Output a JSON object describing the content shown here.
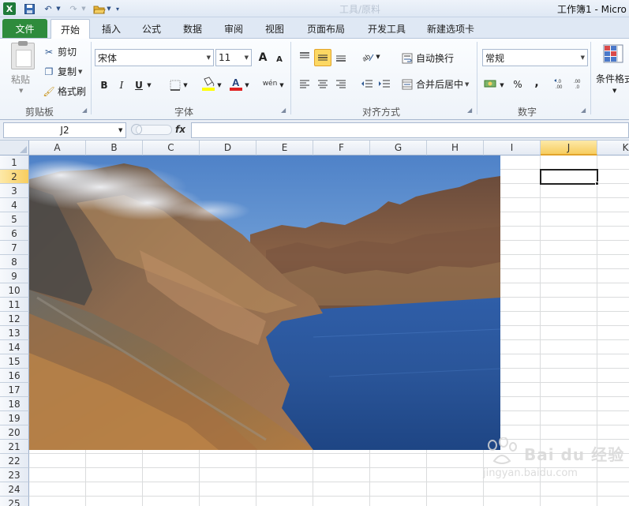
{
  "window": {
    "title": "工作簿1 - Micro",
    "faded_title": "工具/原料"
  },
  "quick_access": {
    "app_icon": "X",
    "save_icon": "save-icon",
    "undo_icon": "undo-icon",
    "redo_icon": "redo-icon",
    "open_icon": "open-folder-icon"
  },
  "tabs": {
    "file": "文件",
    "home": "开始",
    "insert": "插入",
    "formulas": "公式",
    "data": "数据",
    "review": "审阅",
    "view": "视图",
    "page_layout": "页面布局",
    "developer": "开发工具",
    "new_tab": "新建选项卡"
  },
  "clipboard": {
    "paste": "粘贴",
    "cut": "剪切",
    "copy": "复制",
    "format_painter": "格式刷",
    "group_label": "剪贴板"
  },
  "font": {
    "name": "宋体",
    "size": "11",
    "bold": "B",
    "italic": "I",
    "underline": "U",
    "grow": "A",
    "shrink": "A",
    "group_label": "字体"
  },
  "alignment": {
    "wrap_text": "自动换行",
    "merge_center": "合并后居中",
    "group_label": "对齐方式"
  },
  "number": {
    "format": "常规",
    "percent": "%",
    "comma": ",",
    "group_label": "数字"
  },
  "styles": {
    "conditional_format": "条件格式"
  },
  "formula_bar": {
    "name_box": "J2",
    "fx": "fx",
    "formula": ""
  },
  "sheet": {
    "columns": [
      "A",
      "B",
      "C",
      "D",
      "E",
      "F",
      "G",
      "H",
      "I",
      "J",
      "K"
    ],
    "rows": [
      "1",
      "2",
      "3",
      "4",
      "5",
      "6",
      "7",
      "8",
      "9",
      "10",
      "11",
      "12",
      "13",
      "14",
      "15",
      "16",
      "17",
      "18",
      "19",
      "20",
      "21",
      "22",
      "23",
      "24",
      "25"
    ],
    "active_cell": "J2",
    "picture": "mountain-crater-lake-photo"
  },
  "watermark": {
    "brand": "Bai du 经验",
    "url": "jingyan.baidu.com"
  },
  "colors": {
    "file_tab": "#2e8b3c",
    "selected_header": "#f7cd5f",
    "highlight_yellow": "#ffff00",
    "font_red": "#e02020"
  }
}
